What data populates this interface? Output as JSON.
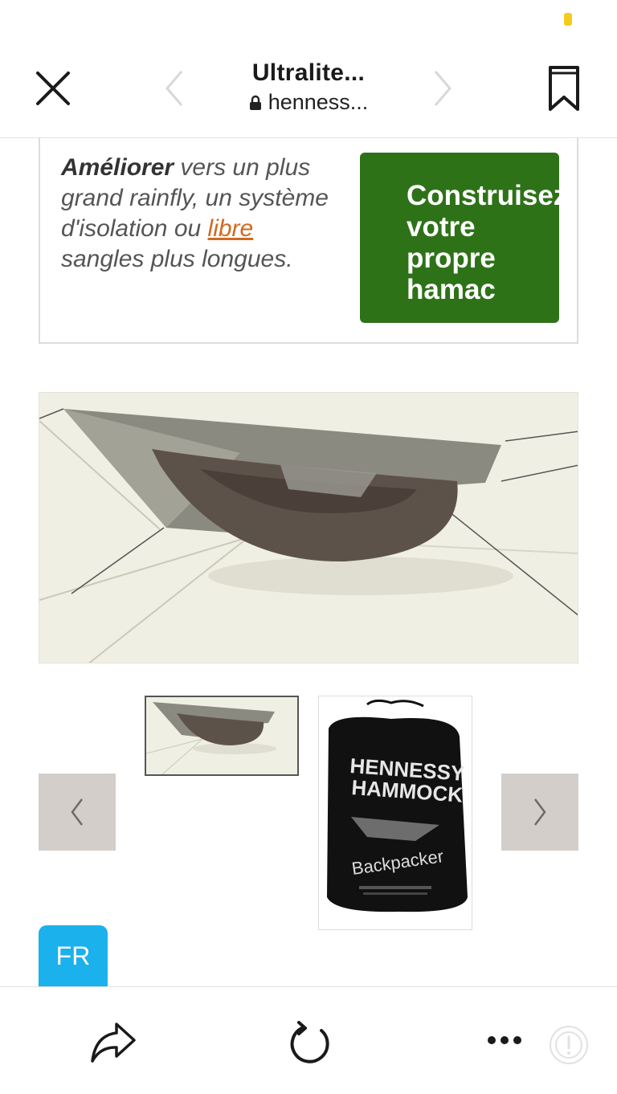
{
  "colors": {
    "accent_green": "#2e7218",
    "badge_blue": "#1ab1ec",
    "link_orange": "#d2691e",
    "status_dot": "#f5cc1c"
  },
  "header": {
    "title": "Ultralite...",
    "url": "henness...",
    "close_icon": "close-icon",
    "back_icon": "chevron-left-icon",
    "forward_icon": "chevron-right-icon",
    "bookmark_icon": "bookmark-icon",
    "lock_icon": "lock-icon"
  },
  "upgrade": {
    "bold": "Améliorer",
    "text_1": " vers un plus grand rainfly, un système d'isolation ou ",
    "link": "libre ",
    "text_2": "sangles plus longues.",
    "button_label": "Construisez\nvotre\npropre\nhamac"
  },
  "gallery": {
    "main_image": "hammock-with-rainfly-image",
    "thumbnails": [
      "hammock-thumbnail",
      "stuff-sack-thumbnail"
    ],
    "bag_text": {
      "line_1": "HENNESSY",
      "line_2": "HAMMOCK",
      "line_3": "Backpacker"
    }
  },
  "lang": {
    "label": "FR"
  },
  "toolbar": {
    "share_icon": "share-icon",
    "refresh_icon": "refresh-icon",
    "more_icon": "more-icon",
    "info_icon": "info-icon"
  }
}
